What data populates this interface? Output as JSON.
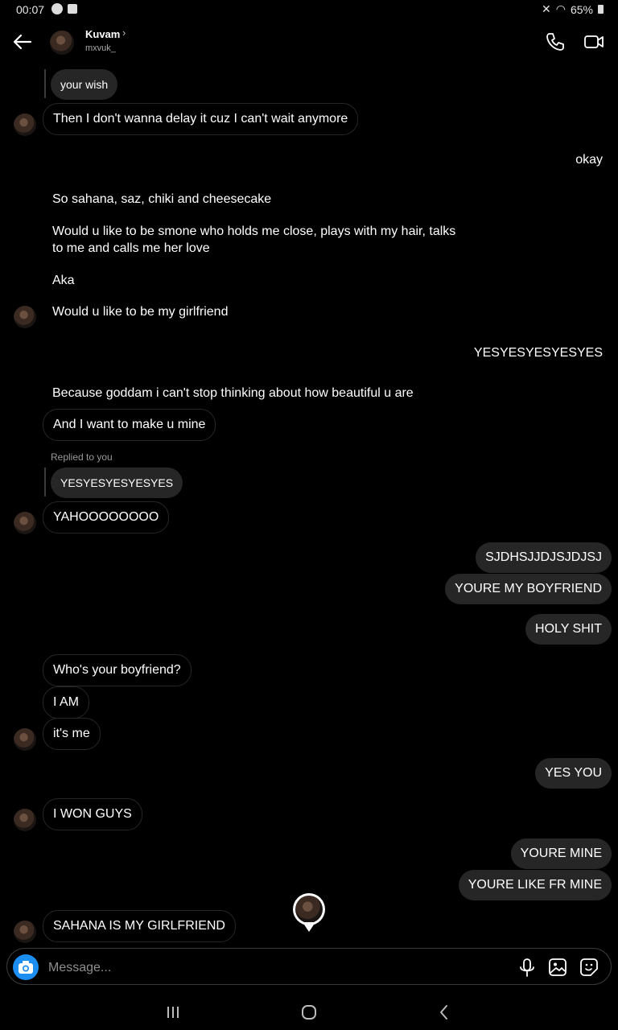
{
  "status": {
    "time": "00:07",
    "battery": "65%"
  },
  "header": {
    "name": "Kuvam",
    "chevron": "›",
    "username": "mxvuk_"
  },
  "messages": {
    "m1": "your wish",
    "m2": "Then I don't wanna delay it cuz I can't wait anymore",
    "m3": "okay",
    "m4": "So sahana, saz, chiki and cheesecake",
    "m5": "Would u like to be smone who holds me close, plays with my hair, talks",
    "m5b": "to me and calls me her love",
    "m6": "Aka",
    "m7": "Would u like to be my girlfriend",
    "m8": "YESYESYESYESYES",
    "m9": "Because goddam i can't stop thinking about how beautiful u are",
    "m10": "And I want to make u mine",
    "reply_label": "Replied to you",
    "m11": "YESYESYESYESYES",
    "m12": "YAHOOOOOOOO",
    "m13": "SJDHSJJDJSJDJSJ",
    "m14": "YOURE MY BOYFRIEND",
    "m15": "HOLY SHIT",
    "m16": "Who's your boyfriend?",
    "m17": "I AM",
    "m18": "it's me",
    "m19": "YES YOU",
    "m20": "I WON GUYS",
    "m21": "YOURE MINE",
    "m22": "YOURE LIKE FR MINE",
    "m23": "SAHANA IS MY GIRLFRIEND"
  },
  "composer": {
    "placeholder": "Message..."
  }
}
